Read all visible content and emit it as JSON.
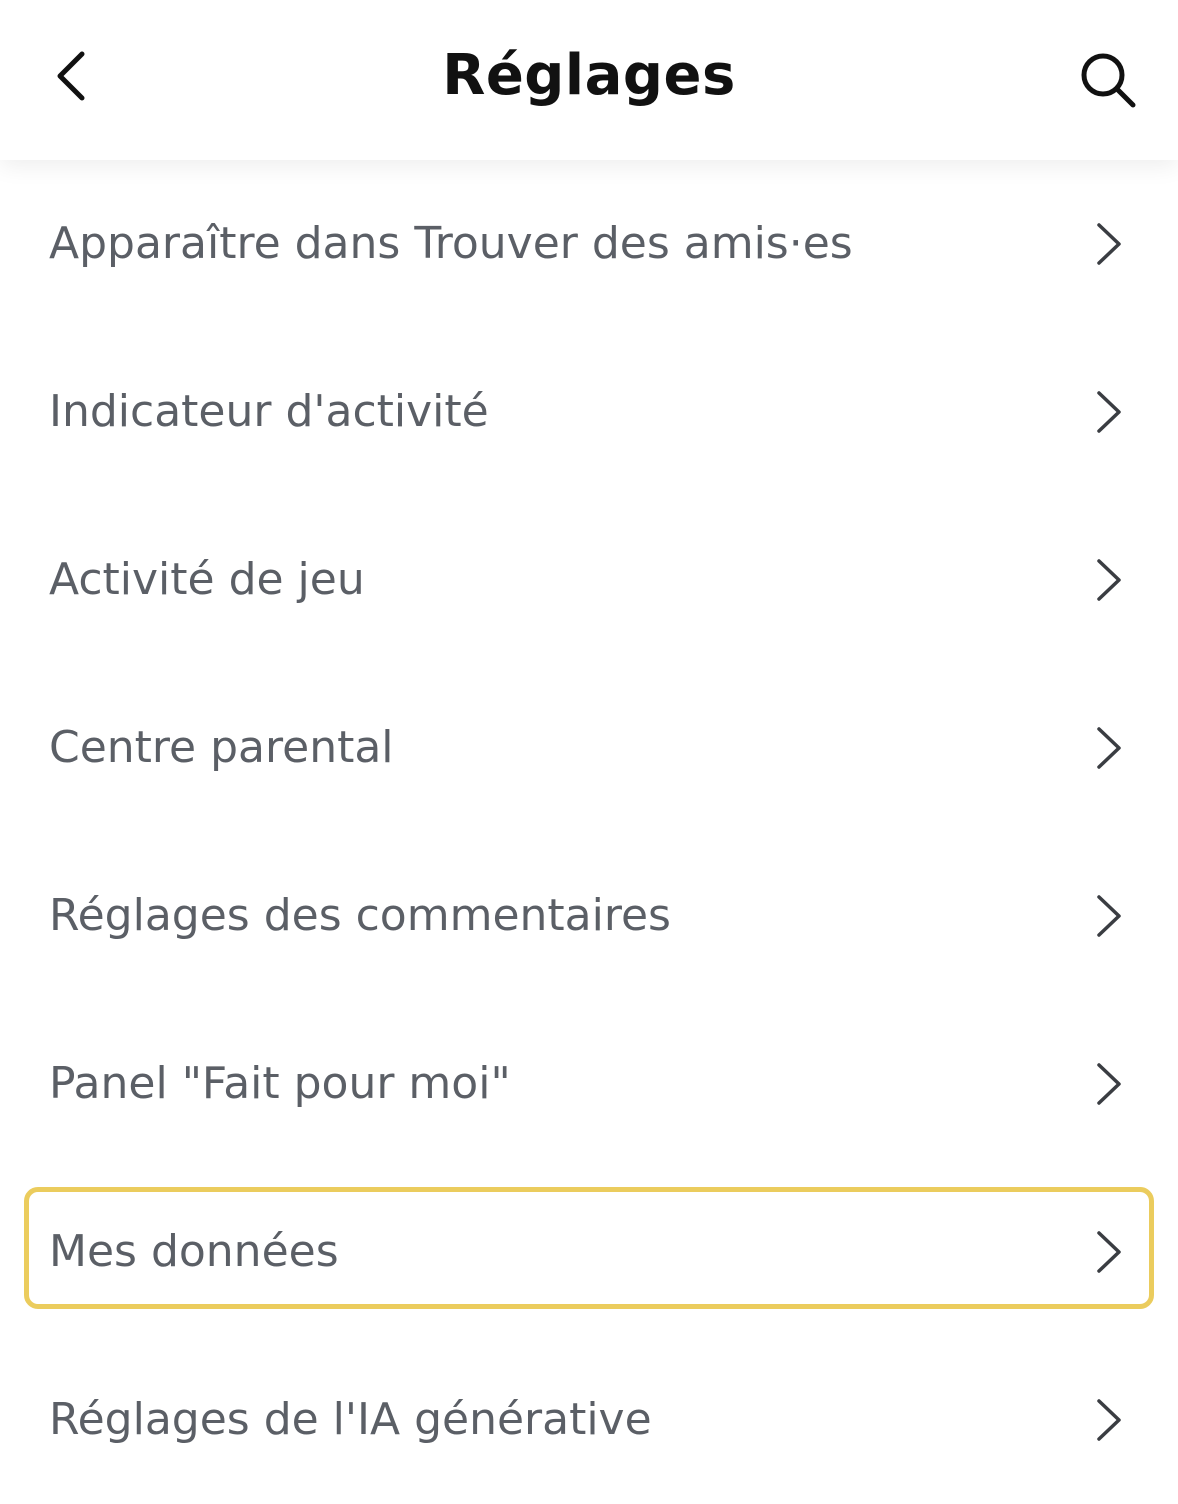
{
  "header": {
    "title": "Réglages",
    "back_icon": "chevron-left-icon",
    "search_icon": "search-icon"
  },
  "items": [
    {
      "label": "Apparaître dans Trouver des amis·es"
    },
    {
      "label": "Indicateur d'activité"
    },
    {
      "label": "Activité de jeu"
    },
    {
      "label": "Centre parental"
    },
    {
      "label": "Réglages des commentaires"
    },
    {
      "label": "Panel \"Fait pour moi\""
    },
    {
      "label": "Mes données"
    },
    {
      "label": "Réglages de l'IA générative"
    }
  ],
  "colors": {
    "highlight": "#ebcc5d",
    "label_text": "#5b5f66",
    "title_text": "#111111"
  }
}
